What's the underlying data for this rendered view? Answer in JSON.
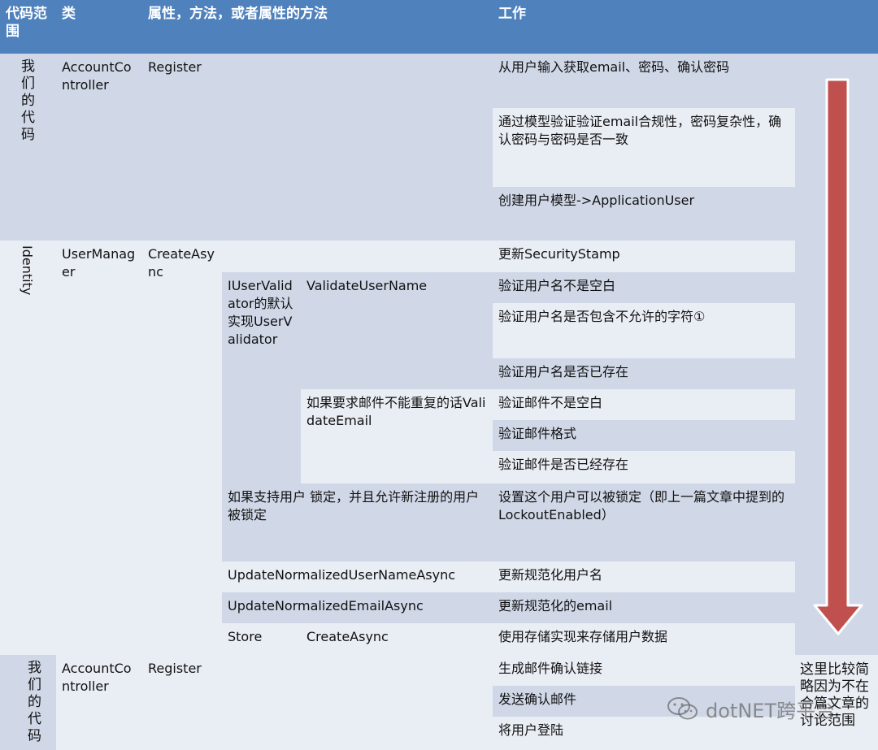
{
  "headers": {
    "scope": "代码范围",
    "class": "类",
    "member": "属性，方法，或者属性的方法",
    "work": "工作"
  },
  "scopes": {
    "ours_top": "我们的代码",
    "identity": "Identity",
    "ours_bottom": "我们的代码"
  },
  "classes": {
    "account_top": "AccountController",
    "usermanager": "UserManager",
    "account_bottom": "AccountController"
  },
  "members": {
    "register_top": "Register",
    "create_async": "CreateAsync",
    "user_validator": "IUserValidator的默认实现UserValidator",
    "validate_user_name": "ValidateUserName",
    "validate_email": "如果要求邮件不能重复的话ValidateEmail",
    "lockout": "如果支持用户 锁定，并且允许新注册的用户被锁定",
    "update_normalized_username": "UpdateNormalizedUserNameAsync",
    "update_normalized_email": "UpdateNormalizedEmailAsync",
    "store": "Store",
    "store_create_async": "CreateAsync",
    "register_bottom": "Register"
  },
  "work": [
    "从用户输入获取email、密码、确认密码",
    "通过模型验证验证email合规性，密码复杂性，确认密码与密码是否一致",
    "创建用户模型->ApplicationUser",
    "更新SecurityStamp",
    "验证用户名不是空白",
    "验证用户名是否包含不允许的字符①",
    "验证用户名是否已存在",
    "验证邮件不是空白",
    "验证邮件格式",
    "验证邮件是否已经存在",
    "设置这个用户可以被锁定（即上一篇文章中提到的LockoutEnabled）",
    "更新规范化用户名",
    "更新规范化的email",
    "使用存储实现来存储用户数据",
    "生成邮件确认链接",
    "发送确认邮件",
    "将用户登陆"
  ],
  "note": "这里比较简略因为不在合篇文章的讨论范围",
  "watermark": "dotNET跨平台",
  "colors": {
    "header": "#4f81bd",
    "row_dark": "#d0d8e8",
    "row_light": "#e9edf4",
    "arrow": "#c0504d"
  }
}
